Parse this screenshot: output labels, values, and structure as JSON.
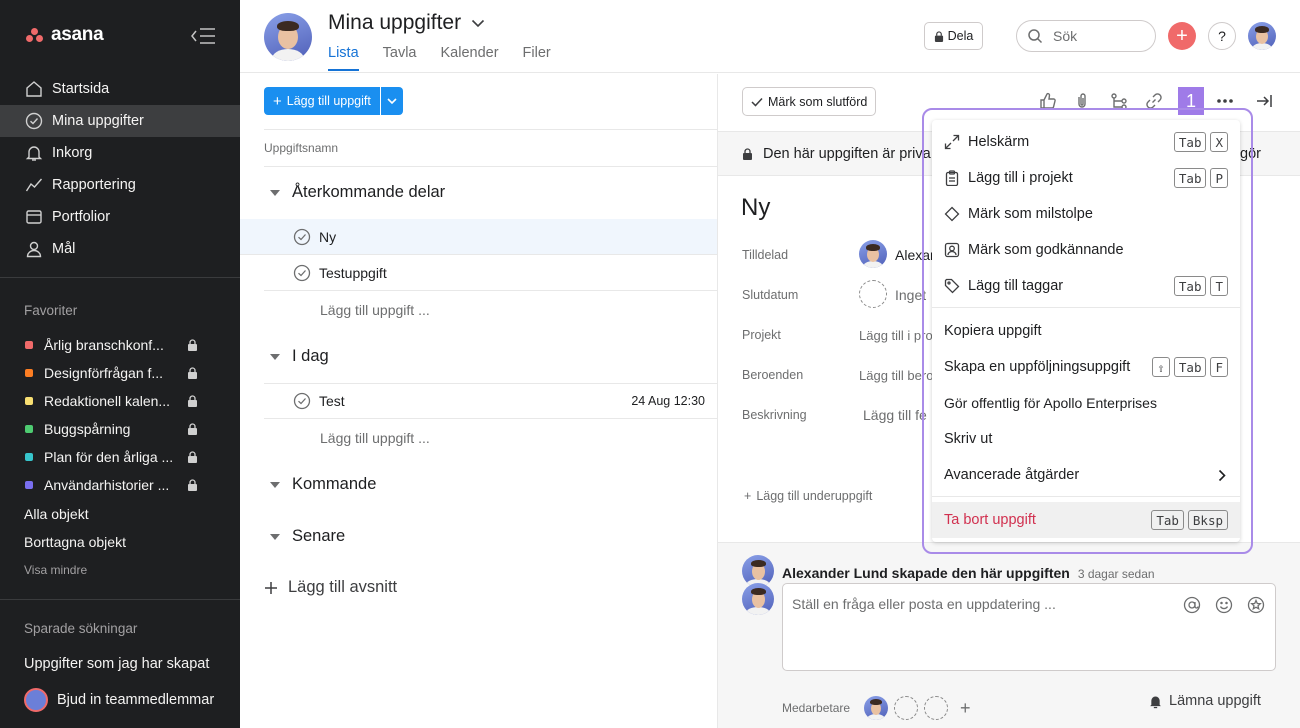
{
  "brand": {
    "name": "asana",
    "accent": "#f06a6a",
    "link_blue": "#1573d6"
  },
  "sidebar": {
    "nav": [
      {
        "label": "Startsida",
        "icon": "home-icon"
      },
      {
        "label": "Mina uppgifter",
        "icon": "check-circle-icon",
        "active": true
      },
      {
        "label": "Inkorg",
        "icon": "bell-icon"
      },
      {
        "label": "Rapportering",
        "icon": "chart-line-icon"
      },
      {
        "label": "Portfolior",
        "icon": "folder-icon"
      },
      {
        "label": "Mål",
        "icon": "person-icon"
      }
    ],
    "favorites_heading": "Favoriter",
    "favorites": [
      {
        "label": "Årlig branschkonf...",
        "color": "#f06a6a"
      },
      {
        "label": "Designförfrågan f...",
        "color": "#fd7e23"
      },
      {
        "label": "Redaktionell kalen...",
        "color": "#f8df72"
      },
      {
        "label": "Buggspårning",
        "color": "#4ecb71"
      },
      {
        "label": "Plan för den årliga ...",
        "color": "#37c5cc"
      },
      {
        "label": "Användarhistorier ...",
        "color": "#7a6ff0"
      }
    ],
    "all_objects": "Alla objekt",
    "deleted_objects": "Borttagna objekt",
    "show_less": "Visa mindre",
    "saved_searches_heading": "Sparade sökningar",
    "saved_search_item": "Uppgifter som jag har skapat",
    "invite": "Bjud in teammedlemmar"
  },
  "header": {
    "title": "Mina uppgifter",
    "tabs": [
      "Lista",
      "Tavla",
      "Kalender",
      "Filer"
    ],
    "share": "Dela",
    "search_placeholder": "Sök",
    "help": "?"
  },
  "list": {
    "add_task": "Lägg till uppgift",
    "column_header": "Uppgiftsnamn",
    "sections": [
      {
        "title": "Återkommande delar",
        "tasks": [
          {
            "name": "Ny",
            "selected": true
          },
          {
            "name": "Testuppgift"
          }
        ],
        "add_label": "Lägg till uppgift ..."
      },
      {
        "title": "I dag",
        "tasks": [
          {
            "name": "Test",
            "date": "24 Aug 12:30"
          }
        ],
        "add_label": "Lägg till uppgift ..."
      },
      {
        "title": "Kommande"
      },
      {
        "title": "Senare"
      }
    ],
    "add_section": "Lägg till avsnitt"
  },
  "detail": {
    "mark_complete": "Märk som slutförd",
    "step_badge": "1",
    "private_notice": "Den här uppgiften är priva",
    "private_notice_tail": "gör",
    "task_name": "Ny",
    "fields": [
      {
        "label": "Tilldelad",
        "value": "Alexan"
      },
      {
        "label": "Slutdatum",
        "value": "Inget"
      },
      {
        "label": "Projekt",
        "value": "Lägg till i pro"
      },
      {
        "label": "Beroenden",
        "value": "Lägg till bero"
      },
      {
        "label": "Beskrivning",
        "value": "Lägg till fe"
      }
    ],
    "add_subtask": "Lägg till underuppgift",
    "activity": {
      "text": "Alexander Lund skapade den här uppgiften",
      "time": "3 dagar sedan"
    },
    "comment_placeholder": "Ställ en fråga eller posta en uppdatering ...",
    "collaborators_label": "Medarbetare",
    "leave_task": "Lämna uppgift"
  },
  "menu": {
    "items": [
      {
        "label": "Helskärm",
        "icon": "expand-icon",
        "keys": [
          "Tab",
          "X"
        ]
      },
      {
        "label": "Lägg till i projekt",
        "icon": "clipboard-icon",
        "keys": [
          "Tab",
          "P"
        ]
      },
      {
        "label": "Märk som milstolpe",
        "icon": "diamond-icon",
        "keys": []
      },
      {
        "label": "Märk som godkännande",
        "icon": "approval-icon",
        "keys": []
      },
      {
        "label": "Lägg till taggar",
        "icon": "tag-icon",
        "keys": [
          "Tab",
          "T"
        ]
      },
      {
        "label": "Kopiera uppgift",
        "keys": []
      },
      {
        "label": "Skapa en uppföljningsuppgift",
        "keys": [
          "⇧",
          "Tab",
          "F"
        ]
      },
      {
        "label": "Gör offentlig för Apollo Enterprises",
        "keys": []
      },
      {
        "label": "Skriv ut",
        "keys": []
      },
      {
        "label": "Avancerade åtgärder",
        "submenu": true,
        "keys": []
      },
      {
        "label": "Ta bort uppgift",
        "danger": true,
        "keys": [
          "Tab",
          "Bksp"
        ]
      }
    ]
  }
}
